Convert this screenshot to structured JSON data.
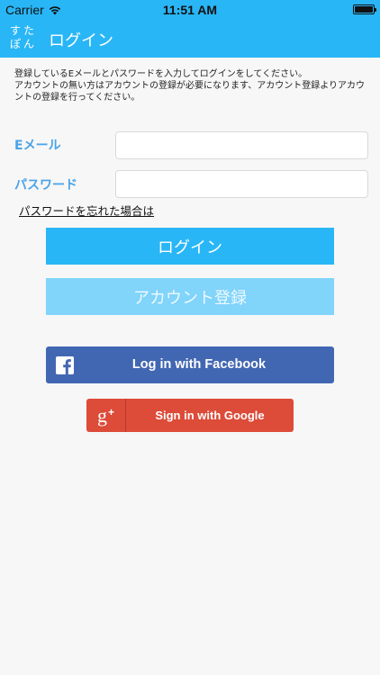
{
  "status_bar": {
    "carrier": "Carrier",
    "time": "11:51 AM",
    "icons": [
      "wifi-icon",
      "battery-icon"
    ]
  },
  "nav": {
    "logo_chars": [
      "す",
      "た",
      "ぽ",
      "ん"
    ],
    "title": "ログイン"
  },
  "instructions": {
    "line1": "登録しているEメールとパスワードを入力してログインをしてください。",
    "line2": "アカウントの無い方はアカウントの登録が必要になります、アカウント登録よりアカウントの登録を行ってください。"
  },
  "form": {
    "email_label": "Eメール",
    "email_value": "",
    "password_label": "パスワード",
    "password_value": "",
    "forgot_link": "パスワードを忘れた場合は"
  },
  "buttons": {
    "login": "ログイン",
    "register": "アカウント登録",
    "facebook": "Log in with Facebook",
    "google": "Sign in with Google"
  },
  "colors": {
    "header": "#29b6f6",
    "primary_button": "#29b6f6",
    "secondary_button": "#81d4fa",
    "label": "#4aa3e8",
    "facebook": "#4267b2",
    "google": "#dd4b39",
    "background": "#f7f7f7"
  }
}
